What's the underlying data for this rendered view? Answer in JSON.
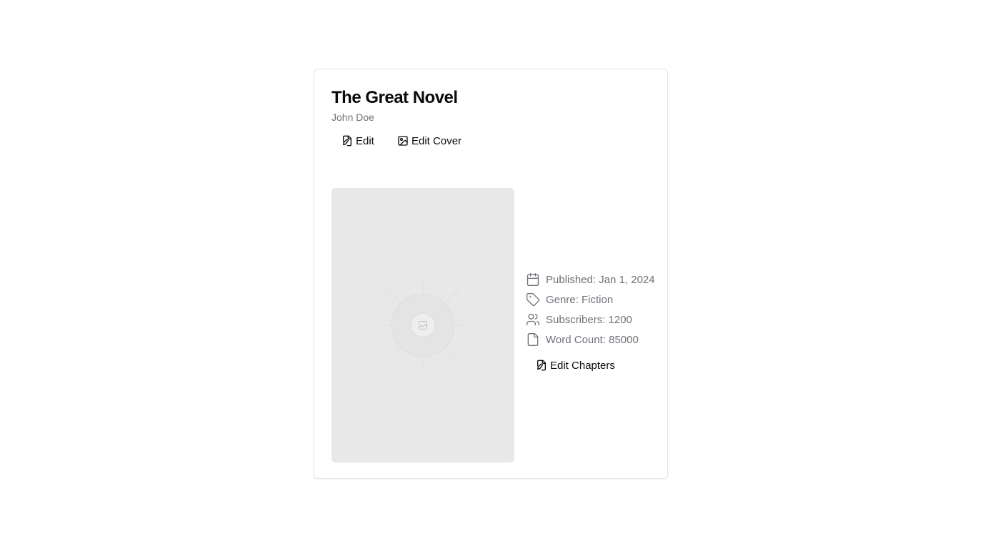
{
  "book": {
    "title": "The Great Novel",
    "author": "John Doe"
  },
  "actions": {
    "edit_label": "Edit",
    "edit_cover_label": "Edit Cover",
    "edit_chapters_label": "Edit Chapters"
  },
  "meta": {
    "published": "Published: Jan 1, 2024",
    "genre": "Genre: Fiction",
    "subscribers": "Subscribers: 1200",
    "word_count": "Word Count: 85000"
  },
  "icons": {
    "edit": "file-pen-icon",
    "edit_cover": "image-icon",
    "published": "calendar-icon",
    "genre": "tag-icon",
    "subscribers": "users-icon",
    "word_count": "file-icon",
    "cover_placeholder": "image-placeholder-icon"
  },
  "colors": {
    "text": "#0a0a0a",
    "muted": "#71717a",
    "border": "#e4e4e7",
    "cover_bg": "#e8e8e8"
  }
}
